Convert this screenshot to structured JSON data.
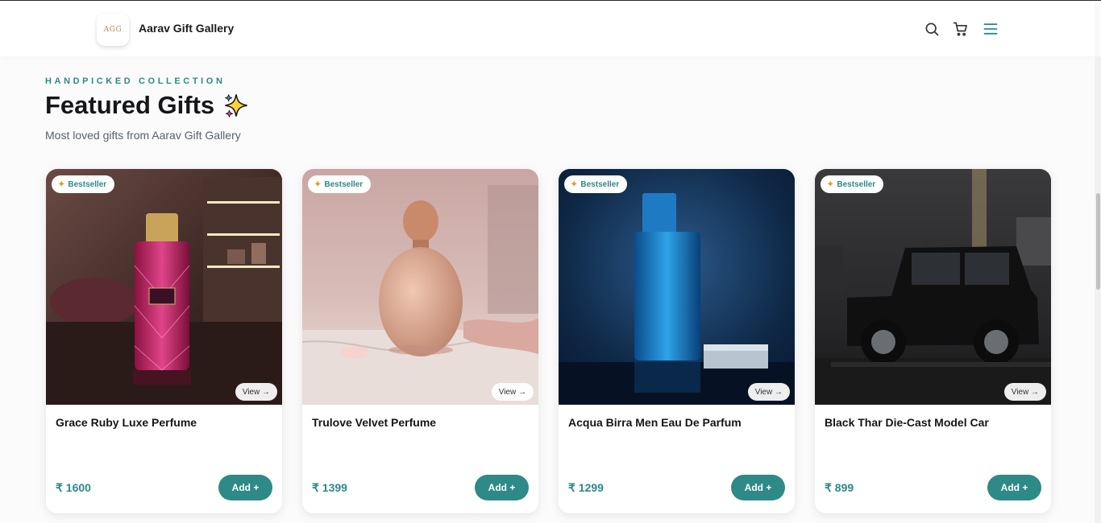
{
  "header": {
    "logo_text": "AGG",
    "brand": "Aarav Gift Gallery",
    "icons": [
      "search-icon",
      "cart-icon",
      "menu-icon"
    ]
  },
  "section": {
    "eyebrow": "HANDPICKED COLLECTION",
    "title": "Featured Gifts",
    "subtitle": "Most loved gifts from Aarav Gift Gallery"
  },
  "colors": {
    "accent": "#2d8a86",
    "title": "#15161a"
  },
  "products": [
    {
      "badge": "Bestseller",
      "view": "View →",
      "name": "Grace Ruby Luxe Perfume",
      "price": "₹ 1600",
      "add": "Add +"
    },
    {
      "badge": "Bestseller",
      "view": "View →",
      "name": "Trulove Velvet Perfume",
      "price": "₹ 1399",
      "add": "Add +"
    },
    {
      "badge": "Bestseller",
      "view": "View →",
      "name": "Acqua Birra Men Eau De Parfum",
      "price": "₹ 1299",
      "add": "Add +"
    },
    {
      "badge": "Bestseller",
      "view": "View →",
      "name": "Black Thar Die-Cast Model Car",
      "price": "₹ 899",
      "add": "Add +"
    }
  ]
}
